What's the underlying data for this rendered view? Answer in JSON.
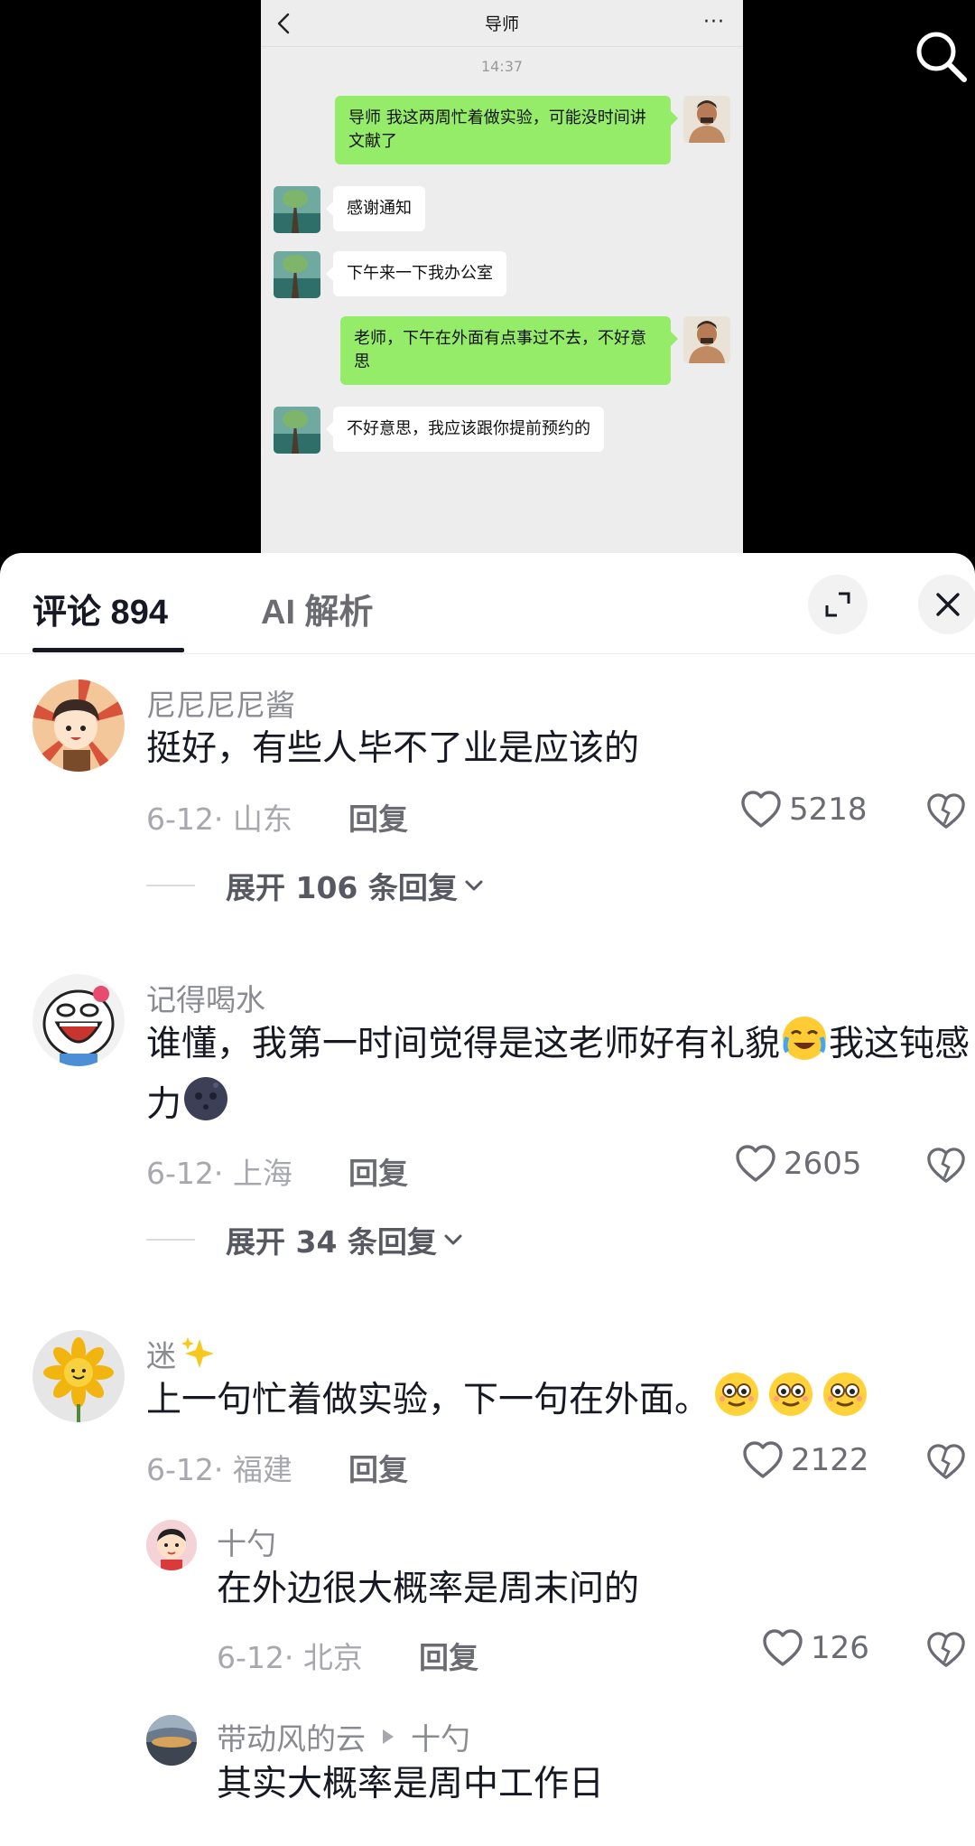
{
  "chat": {
    "title": "导师",
    "time": "14:37",
    "more": "···",
    "messages": [
      {
        "side": "right",
        "text": "导师 我这两周忙着做实验，可能没时间讲文献了"
      },
      {
        "side": "left",
        "text": "感谢通知"
      },
      {
        "side": "left",
        "text": "下午来一下我办公室"
      },
      {
        "side": "right",
        "text": "老师，下午在外面有点事过不去，不好意思"
      },
      {
        "side": "left",
        "text": "不好意思，我应该跟你提前预约的"
      }
    ]
  },
  "sheet": {
    "tab_comments": "评论 894",
    "tab_ai": "AI 解析"
  },
  "comments": [
    {
      "user": "尼尼尼尼酱",
      "text": "挺好，有些人毕不了业是应该的",
      "meta": "6-12· 山东",
      "reply_label": "回复",
      "likes": "5218",
      "expand": "展开 106 条回复"
    },
    {
      "user": "记得喝水",
      "text_part1": "谁懂，我第一时间觉得是这老师好有礼貌",
      "text_part2": "我这钝感力",
      "meta": "6-12· 上海",
      "reply_label": "回复",
      "likes": "2605",
      "expand": "展开 34 条回复"
    },
    {
      "user": "迷",
      "text": "上一句忙着做实验，下一句在外面。",
      "meta": "6-12· 福建",
      "reply_label": "回复",
      "likes": "2122"
    },
    {
      "user": "十勺",
      "text": "在外边很大概率是周末问的",
      "meta": "6-12· 北京",
      "reply_label": "回复",
      "likes": "126"
    },
    {
      "user": "带动风的云",
      "reply_to": "十勺",
      "text": "其实大概率是周中工作日"
    }
  ],
  "icons": {
    "search": "search-icon",
    "back": "chevron-left-icon",
    "expand": "expand-icon",
    "close": "close-icon",
    "like": "heart-outline-icon",
    "dislike": "broken-heart-icon",
    "expand_arrow": "chevron-down-icon"
  },
  "colors": {
    "wechat_green": "#95ec69",
    "chat_bg": "#ededed",
    "text_primary": "#161823",
    "text_secondary": "#8a8b91"
  }
}
